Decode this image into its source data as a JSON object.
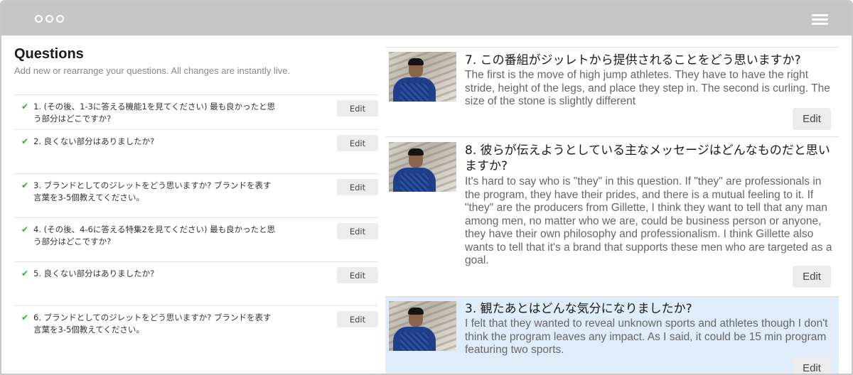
{
  "titlebar": {
    "window_dots": [
      "dot",
      "dot",
      "dot"
    ],
    "menu_icon": "hamburger-icon"
  },
  "questions": {
    "title": "Questions",
    "subtitle": "Add new or rearrange your questions. All changes are instantly live.",
    "edit_label": "Edit",
    "check_icon": "checkmark-icon",
    "check_color": "#2ab12a",
    "items": [
      {
        "text": "1. (その後、1-3に答える機能1を見てください) 最も良かったと思う部分はどこですか?"
      },
      {
        "text": "2. 良くない部分はありましたか?"
      },
      {
        "text": "3. ブランドとしてのジレットをどう思いますか? ブランドを表す言葉を3-5個教えてください。"
      },
      {
        "text": "4. (その後、4-6に答える特集2を見てください) 最も良かったと思う部分はどこですか?"
      },
      {
        "text": "5. 良くない部分はありましたか?"
      },
      {
        "text": "6. ブランドとしてのジレットをどう思いますか? ブランドを表す言葉を3-5個教えてください。"
      }
    ]
  },
  "responses": {
    "edit_label": "Edit",
    "highlight_color": "#deedf9",
    "items": [
      {
        "title": "7. この番組がジッレトから提供されることをどう思いますか?",
        "body": "The first is the move of high jump athletes. They have to have the right stride, height of the legs, and place they step in. The second is curling. The size of the stone is slightly different"
      },
      {
        "title": "8. 彼らが伝えようとしている主なメッセージはどんなものだと思いますか?",
        "body": "It's hard to say who is \"they\" in this question. If \"they\" are professionals in the program, they have their prides, and there is a mutual feeling to it. If \"they\" are the producers from Gillette, I think they want to tell that any man among men, no matter who we are, could be business person or anyone, they have their own philosophy and professionalism. I think Gillette also wants to tell that it's a brand that supports these men who are targeted as a goal."
      },
      {
        "title": "3. 観たあとはどんな気分になりましたか?",
        "body": "I felt that they wanted to reveal unknown sports and athletes though I don't think the program leaves any impact. As I said, it could be 15 min program featuring two sports."
      }
    ]
  }
}
